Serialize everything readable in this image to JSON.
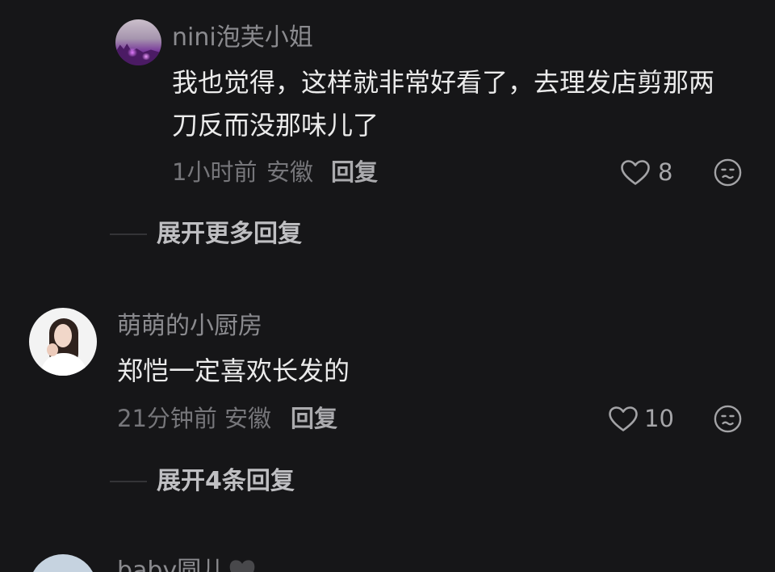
{
  "colors": {
    "background": "#161618",
    "text_primary": "#ebebeb",
    "text_secondary": "#8b8b8f",
    "icon": "#a3a3a6"
  },
  "comments": [
    {
      "username": "nini泡芙小姐",
      "text": "我也觉得，这样就非常好看了，去理发店剪那两刀反而没那味儿了",
      "time": "1小时前",
      "location": "安徽",
      "reply_label": "回复",
      "like_count": 8,
      "like_icon": "heart-outline-icon",
      "dislike_icon": "neutral-face-icon",
      "expand_label": "展开更多回复"
    },
    {
      "username": "萌萌的小厨房",
      "text": "郑恺一定喜欢长发的",
      "time": "21分钟前",
      "location": "安徽",
      "reply_label": "回复",
      "like_count": 10,
      "like_icon": "heart-outline-icon",
      "dislike_icon": "neutral-face-icon",
      "expand_label": "展开4条回复"
    },
    {
      "username": "baby圆儿",
      "name_badge_icon": "black-heart-icon"
    }
  ]
}
